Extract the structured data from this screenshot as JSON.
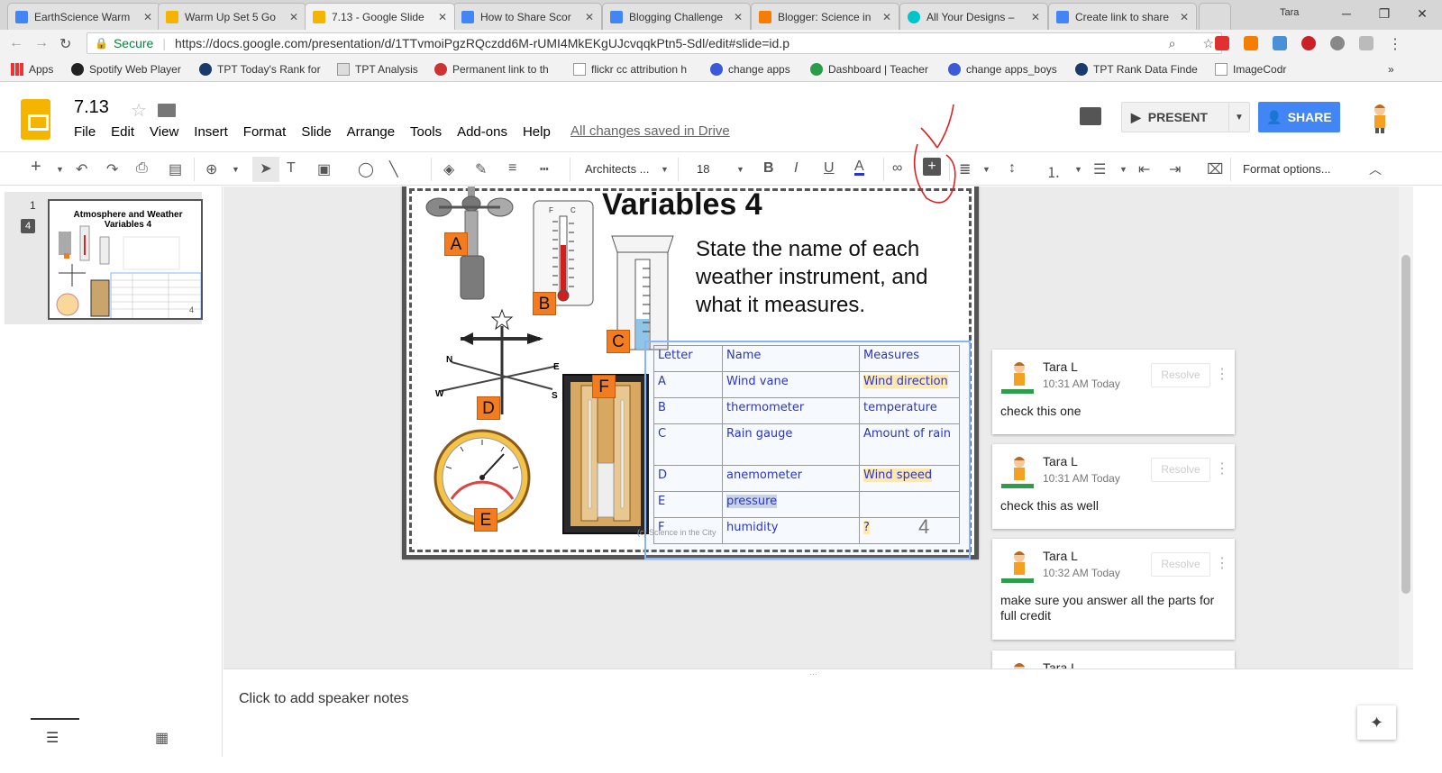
{
  "browser": {
    "tabs": [
      {
        "title": "EarthScience Warm",
        "fav": "#4285f4"
      },
      {
        "title": "Warm Up Set 5 Go",
        "fav": "#f4b400"
      },
      {
        "title": "7.13 - Google Slide",
        "fav": "#f4b400"
      },
      {
        "title": "How to Share Scor",
        "fav": "#4285f4"
      },
      {
        "title": "Blogging Challenge",
        "fav": "#4285f4"
      },
      {
        "title": "Blogger: Science in",
        "fav": "#f57d00"
      },
      {
        "title": "All Your Designs –",
        "fav": "#00c4cc"
      },
      {
        "title": "Create link to share",
        "fav": "#4285f4"
      }
    ],
    "user": "Tara",
    "secure_label": "Secure",
    "url": "https://docs.google.com/presentation/d/1TTvmoiPgzRQczdd6M-rUMI4MkEKgUJcvqqkPtn5-Sdl/edit#slide=id.p",
    "bookmarks": [
      "Apps",
      "Spotify Web Player",
      "TPT Today's Rank for",
      "TPT Analysis",
      "Permanent link to th",
      "flickr cc attribution h",
      "change apps",
      "Dashboard | Teacher",
      "change apps_boys",
      "TPT Rank Data Finde",
      "ImageCodr"
    ]
  },
  "doc": {
    "title": "7.13",
    "menus": [
      "File",
      "Edit",
      "View",
      "Insert",
      "Format",
      "Slide",
      "Arrange",
      "Tools",
      "Add-ons",
      "Help"
    ],
    "saved_status": "All changes saved in Drive",
    "present_label": "PRESENT",
    "share_label": "SHARE"
  },
  "toolbar": {
    "font": "Architects ...",
    "font_size": "18",
    "format_options": "Format options..."
  },
  "filmstrip": {
    "slide_number": "1",
    "badge": "4",
    "thumb_title": "Atmosphere and Weather Variables 4"
  },
  "slide": {
    "title": "Variables 4",
    "instructions": "State the name of each weather instrument, and what it measures.",
    "labels": [
      "A",
      "B",
      "C",
      "D",
      "E",
      "F"
    ],
    "table_header": [
      "Letter",
      "Name",
      "Measures"
    ],
    "rows": [
      [
        "A",
        "Wind vane",
        "Wind direction"
      ],
      [
        "B",
        "thermometer",
        "temperature"
      ],
      [
        "C",
        "Rain gauge",
        "Amount of rain"
      ],
      [
        "D",
        "anemometer",
        "Wind speed"
      ],
      [
        "E",
        "pressure",
        ""
      ],
      [
        "F",
        "humidity",
        "?"
      ]
    ],
    "credit": "(c) Science in the City",
    "page_number": "4"
  },
  "comments": [
    {
      "author": "Tara L",
      "time": "10:31 AM Today",
      "text": "check this one",
      "resolve": "Resolve"
    },
    {
      "author": "Tara L",
      "time": "10:31 AM Today",
      "text": "check this as well",
      "resolve": "Resolve"
    },
    {
      "author": "Tara L",
      "time": "10:32 AM Today",
      "text": "make sure you answer all the parts for full credit",
      "resolve": "Resolve"
    },
    {
      "author": "Tara L"
    }
  ],
  "notes": {
    "placeholder": "Click to add speaker notes"
  },
  "colors": {
    "accent": "#4285f4",
    "label_orange": "#f47c20",
    "table_text": "#2a35c9",
    "annotation_red": "#e02020"
  }
}
